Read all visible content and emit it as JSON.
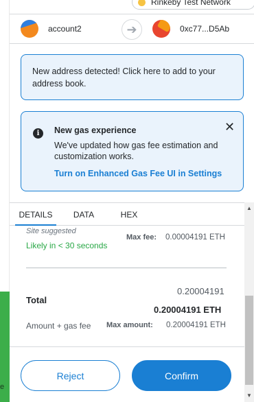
{
  "network": {
    "label": "Rinkeby Test Network",
    "dot_color": "#f6c343"
  },
  "accounts": {
    "from_name": "account2",
    "to_address": "0xc77...D5Ab",
    "arrow_icon": "arrow-right-icon"
  },
  "notice": {
    "text": "New address detected! Click here to add to your address book."
  },
  "gas_notice": {
    "title": "New gas experience",
    "text": "We've updated how gas fee estimation and customization works.",
    "link": "Turn on Enhanced Gas Fee UI in Settings",
    "info_glyph": "i",
    "close_glyph": "✕"
  },
  "tabs": [
    {
      "label": "DETAILS",
      "active": true
    },
    {
      "label": "DATA",
      "active": false
    },
    {
      "label": "HEX",
      "active": false
    }
  ],
  "details": {
    "site_suggested": "Site suggested",
    "likely": "Likely in < 30 seconds",
    "max_fee_label": "Max fee:",
    "max_fee_value": "0.00004191 ETH",
    "total_label": "Total",
    "total_small": "0.20004191",
    "total_big": "0.20004191 ETH",
    "amount_label": "Amount + gas fee",
    "max_amount_label": "Max amount:",
    "max_amount_value": "0.20004191 ETH"
  },
  "footer": {
    "reject_label": "Reject",
    "confirm_label": "Confirm"
  },
  "page_bg_letter": "e",
  "colors": {
    "accent": "#1a7fd3",
    "success": "#28a745",
    "notice_bg": "#eaf3fc"
  }
}
